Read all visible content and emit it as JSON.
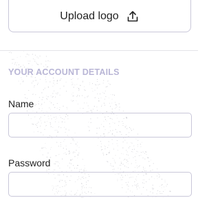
{
  "upload": {
    "label": "Upload logo",
    "icon": "upload-icon"
  },
  "account": {
    "section_title": "YOUR ACCOUNT DETAILS",
    "name": {
      "label": "Name",
      "value": "",
      "placeholder": ""
    },
    "password": {
      "label": "Password",
      "value": "",
      "placeholder": ""
    }
  },
  "colors": {
    "section_title": "#b9b6d6",
    "input_border": "#c9c7d9",
    "text": "#222222",
    "divider": "#e4e4e8"
  }
}
